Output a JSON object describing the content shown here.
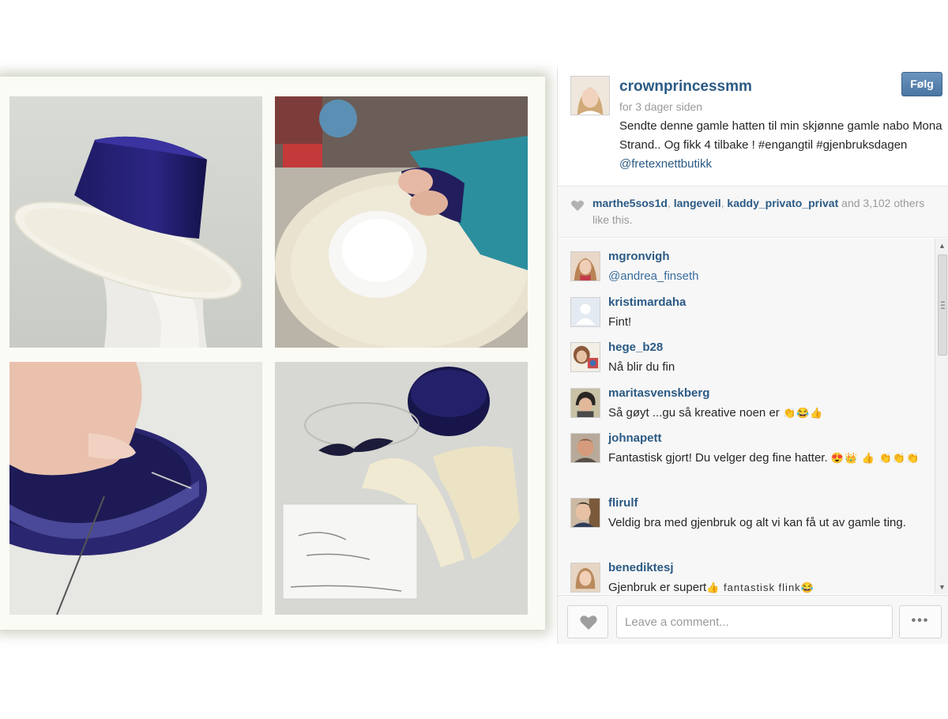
{
  "post": {
    "username": "crownprincessmm",
    "timestamp": "for 3 dager siden",
    "follow_label": "Følg",
    "caption_text": "Sendte denne gamle hatten til min skjønne gamle nabo Mona Strand.. Og fikk 4 tilbake ! #engangtil #gjenbruksdagen",
    "caption_mention": "@fretexnettbutikk"
  },
  "likes": {
    "user1": "marthe5sos1d",
    "user2": "langeveil",
    "user3": "kaddy_privato_privat",
    "suffix": " and 3,102 others like this."
  },
  "comments": [
    {
      "user": "mgronvigh",
      "text": "@andrea_finseth",
      "emoji": ""
    },
    {
      "user": "kristimardaha",
      "text": "Fint!",
      "emoji": ""
    },
    {
      "user": "hege_b28",
      "text": "Nå blir du fin",
      "emoji": ""
    },
    {
      "user": "maritasvenskberg",
      "text": "Så gøyt ...gu så kreative noen er ",
      "emoji": "👏😂👍"
    },
    {
      "user": "johnapett",
      "text": "Fantastisk gjort! Du velger deg fine hatter. ",
      "emoji": "😍👑 👍 👏👏👏"
    },
    {
      "user": "flirulf",
      "text": "Veldig bra med gjenbruk og alt vi kan få ut av gamle ting.",
      "emoji": ""
    },
    {
      "user": "benediktesj",
      "text": "Gjenbruk er supert",
      "emoji": "👍 fantastisk flink😂"
    }
  ],
  "footer": {
    "comment_placeholder": "Leave a comment...",
    "more_label": "•••"
  },
  "colors": {
    "link": "#2b5a84",
    "follow_button": "#4a75a2",
    "panel_bg": "#f7f7f7"
  },
  "icons": {
    "like": "heart-icon",
    "more": "more-icon"
  }
}
